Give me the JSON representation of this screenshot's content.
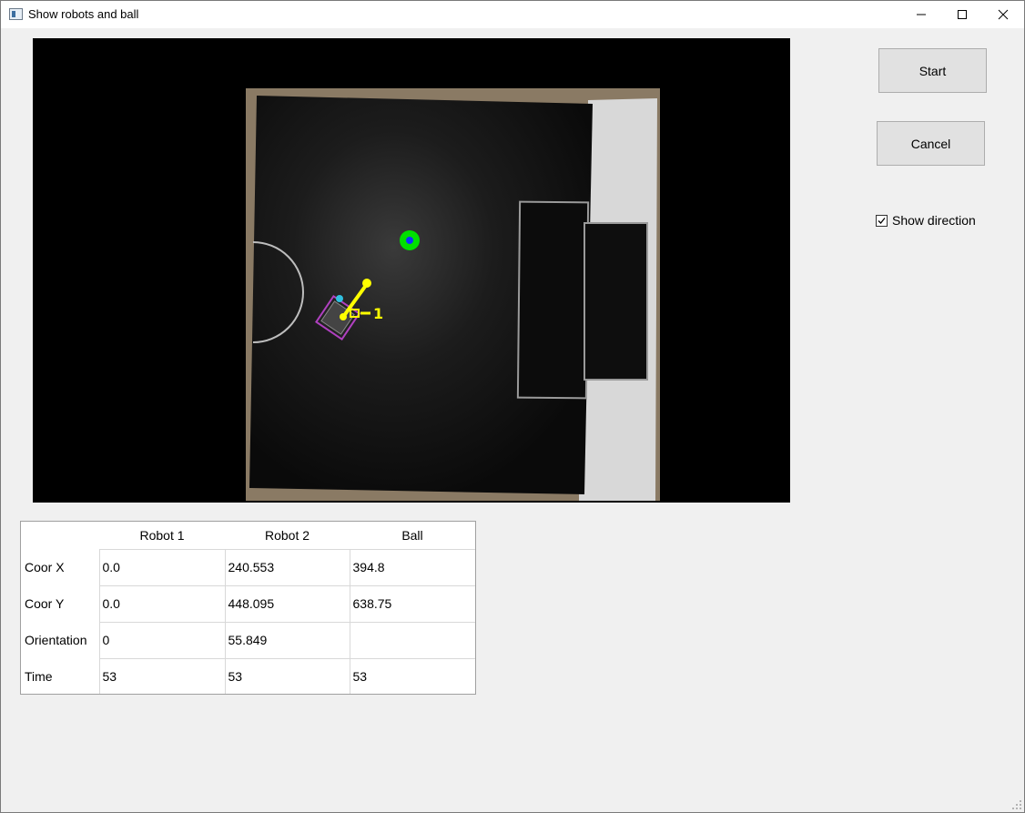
{
  "window": {
    "title": "Show robots and ball",
    "controls": [
      "minimize-icon",
      "maximize-icon",
      "close-icon"
    ]
  },
  "buttons": {
    "start_label": "Start",
    "cancel_label": "Cancel"
  },
  "show_direction": {
    "label": "Show direction",
    "checked": true
  },
  "camera_overlay": {
    "robot_label": "1",
    "colors": {
      "ball": "#00e000",
      "ball_center": "#1030ff",
      "robot_marker": "#ffff00",
      "robot_outline": "#b040c0"
    }
  },
  "table": {
    "columns": [
      "Robot 1",
      "Robot 2",
      "Ball"
    ],
    "rows": [
      {
        "label": "Coor X",
        "values": [
          "0.0",
          "240.553",
          "394.8"
        ]
      },
      {
        "label": "Coor Y",
        "values": [
          "0.0",
          "448.095",
          "638.75"
        ]
      },
      {
        "label": "Orientation",
        "values": [
          "0",
          "55.849",
          ""
        ]
      },
      {
        "label": "Time",
        "values": [
          "53",
          "53",
          "53"
        ]
      }
    ]
  }
}
